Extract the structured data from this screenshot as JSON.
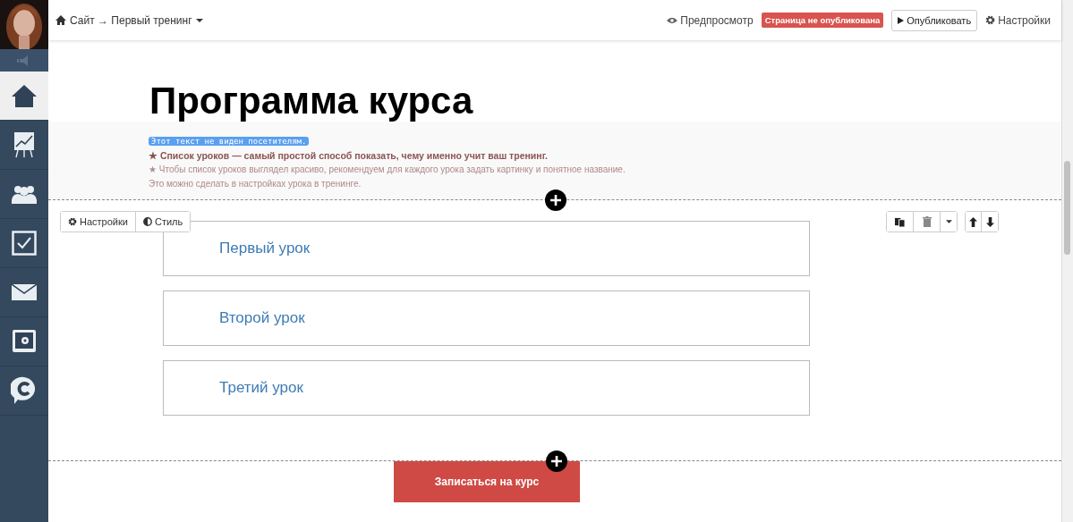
{
  "sidebar": {
    "items": [
      {
        "kind": "home",
        "selected": true
      },
      {
        "kind": "chart",
        "selected": false
      },
      {
        "kind": "users",
        "selected": false
      },
      {
        "kind": "check",
        "selected": false
      },
      {
        "kind": "mail",
        "selected": false
      },
      {
        "kind": "safe",
        "selected": false
      },
      {
        "kind": "chat",
        "selected": false
      }
    ]
  },
  "topbar": {
    "breadcrumb": "Сайт → Первый тренинг",
    "preview": "Предпросмотр",
    "status_badge": "Страница не опубликована",
    "publish_button": "Опубликовать",
    "settings": "Настройки"
  },
  "page": {
    "title": "Программа курса",
    "hint": {
      "hidden_note": "Этот текст не виден посетителям.",
      "lead": "★ Список уроков — самый простой способ показать, чему именно учит ваш тренинг.",
      "tip": "★ Чтобы список уроков выглядел красиво, рекомендуем для каждого урока задать картинку и понятное название.",
      "tip_2": "Это можно сделать в настройках урока в тренинге."
    },
    "block_toolbar": {
      "settings": "Настройки",
      "style": "Стиль"
    },
    "lessons": [
      {
        "title": "Первый урок"
      },
      {
        "title": "Второй урок"
      },
      {
        "title": "Третий урок"
      }
    ],
    "cta_button": "Записаться на курс"
  }
}
